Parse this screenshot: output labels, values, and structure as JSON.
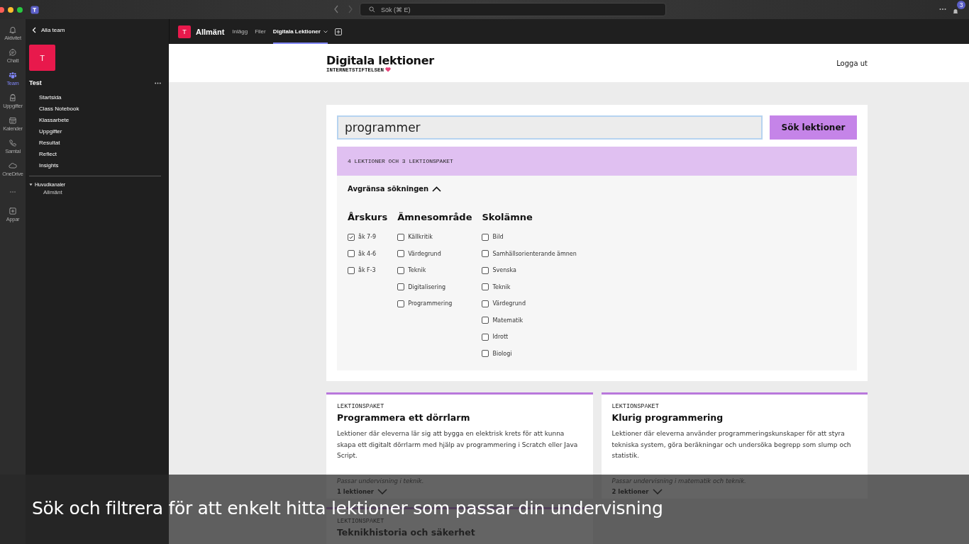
{
  "titlebar": {
    "search_placeholder": "Sök (⌘ E)",
    "notification_count": "3"
  },
  "rail": [
    {
      "kind": "bell",
      "label": "Aktivitet",
      "selected": false
    },
    {
      "kind": "chat",
      "label": "Chatt",
      "selected": false
    },
    {
      "kind": "team",
      "label": "Team",
      "selected": true
    },
    {
      "kind": "bag",
      "label": "Uppgifter",
      "selected": false
    },
    {
      "kind": "calendar",
      "label": "Kalender",
      "selected": false
    },
    {
      "kind": "phone",
      "label": "Samtal",
      "selected": false
    },
    {
      "kind": "cloud",
      "label": "OneDrive",
      "selected": false
    },
    {
      "kind": "more",
      "selected": false
    },
    {
      "kind": "plus",
      "label": "Appar",
      "selected": false
    }
  ],
  "sidebar": {
    "back": "Alla team",
    "team_initial": "T",
    "team_name": "Test",
    "items": [
      "Startsida",
      "Class Notebook",
      "Klassarbete",
      "Uppgifter",
      "Resultat",
      "Reflect",
      "Insights"
    ],
    "channels_header": "Huvudkanaler",
    "channels_expanded": true,
    "channels": [
      "Allmänt"
    ]
  },
  "channel_bar": {
    "initial": "T",
    "name": "Allmänt",
    "tabs": [
      {
        "label": "Inlägg",
        "selected": false
      },
      {
        "label": "Filer",
        "selected": false
      },
      {
        "label": "Digitala Lektioner",
        "selected": true
      }
    ]
  },
  "site": {
    "title": "Digitala lektioner",
    "subtitle": "INTERNETSTIFTELSEN",
    "logout": "Logga ut",
    "search_value": "programmer",
    "search_button": "Sök lektioner",
    "result_count": "4 LEKTIONER OCH 3 LEKTIONSPAKET",
    "filter_toggle": "Avgränsa sökningen",
    "filters_expanded": true,
    "filter_groups": [
      {
        "title": "Årskurs",
        "options": [
          {
            "label": "åk 7-9",
            "checked": true
          },
          {
            "label": "åk 4-6",
            "checked": false
          },
          {
            "label": "åk F-3",
            "checked": false
          }
        ]
      },
      {
        "title": "Ämnesområde",
        "options": [
          {
            "label": "Källkritik",
            "checked": false
          },
          {
            "label": "Värdegrund",
            "checked": false
          },
          {
            "label": "Teknik",
            "checked": false
          },
          {
            "label": "Digitalisering",
            "checked": false
          },
          {
            "label": "Programmering",
            "checked": false
          }
        ]
      },
      {
        "title": "Skolämne",
        "options": [
          {
            "label": "Bild",
            "checked": false
          },
          {
            "label": "Samhällsorienterande ämnen",
            "checked": false
          },
          {
            "label": "Svenska",
            "checked": false
          },
          {
            "label": "Teknik",
            "checked": false
          },
          {
            "label": "Värdegrund",
            "checked": false
          },
          {
            "label": "Matematik",
            "checked": false
          },
          {
            "label": "Idrott",
            "checked": false
          },
          {
            "label": "Biologi",
            "checked": false
          }
        ]
      }
    ]
  },
  "cards": [
    {
      "type_label": "LEKTIONSPAKET",
      "title": "Programmera ett dörrlarm",
      "description": "Lektioner där eleverna lär sig att bygga en elektrisk krets för att kunna skapa ett digitalt dörrlarm med hjälp av programmering i Scratch eller Java Script.",
      "fit": "Passar undervisning i teknik.",
      "count": "1 lektioner"
    },
    {
      "type_label": "LEKTIONSPAKET",
      "title": "Klurig programmering",
      "description": "Lektioner där eleverna använder programmeringskunskaper för att styra tekniska system, göra beräkningar och undersöka begrepp som slump och statistik.",
      "fit": "Passar undervisning i matematik och teknik.",
      "count": "2 lektioner"
    },
    {
      "type_label": "LEKTIONSPAKET",
      "title": "Teknikhistoria och säkerhet"
    }
  ],
  "caption": "Sök och filtrera för att enkelt hitta lektioner som passar din undervisning"
}
